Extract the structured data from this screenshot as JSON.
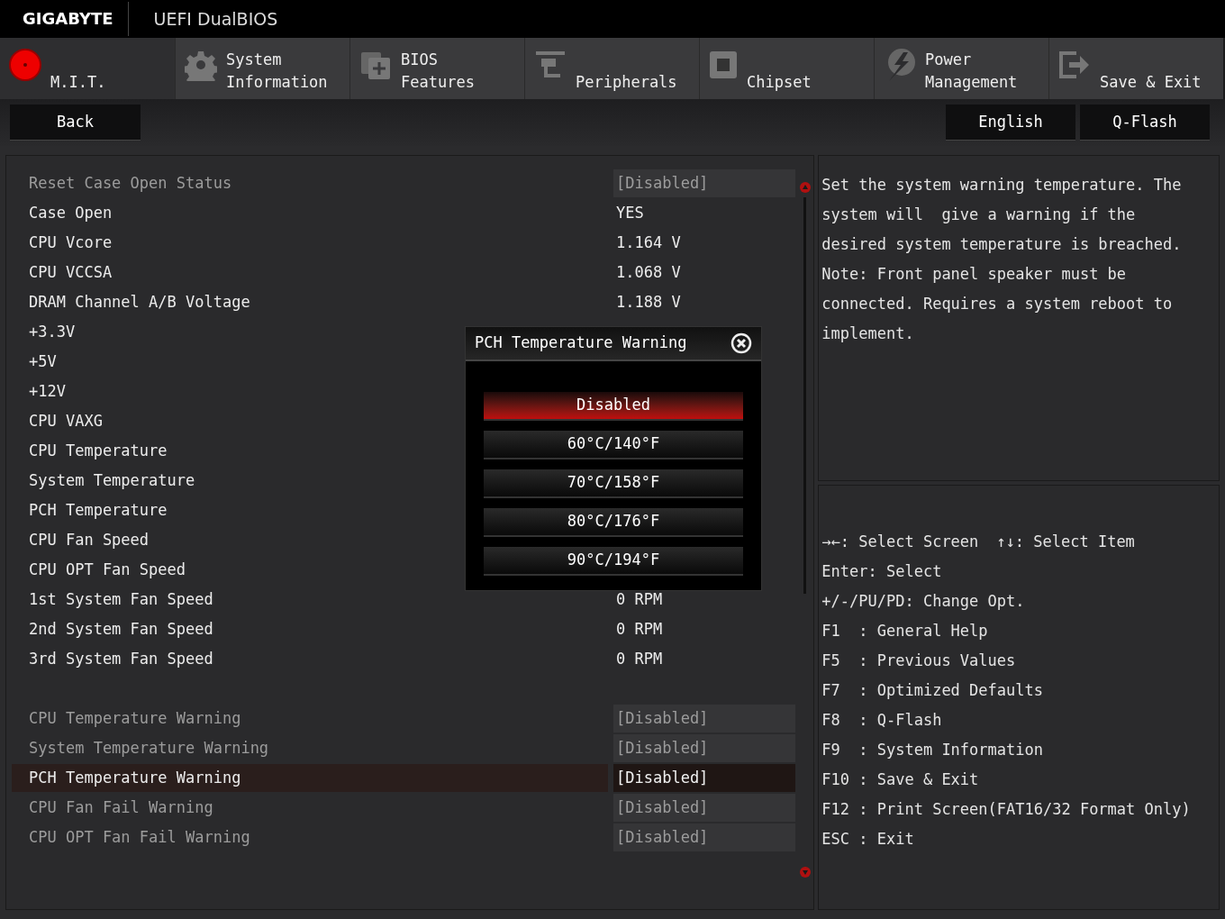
{
  "header": {
    "brand": "GIGABYTE",
    "title": "UEFI DualBIOS"
  },
  "tabs": [
    {
      "label": "M.I.T.",
      "kind": "mit",
      "selected": true
    },
    {
      "label": "System\nInformation",
      "kind": "gear",
      "selected": false
    },
    {
      "label": "BIOS\nFeatures",
      "kind": "card",
      "selected": false
    },
    {
      "label": "Peripherals",
      "kind": "plug",
      "selected": false
    },
    {
      "label": "Chipset",
      "kind": "chip",
      "selected": false
    },
    {
      "label": "Power\nManagement",
      "kind": "power",
      "selected": false
    },
    {
      "label": "Save & Exit",
      "kind": "exit",
      "selected": false
    }
  ],
  "back_button": "Back",
  "right_buttons": [
    "English",
    "Q-Flash"
  ],
  "sections": [
    {
      "rows": [
        {
          "label": "Reset Case Open Status",
          "value": "[Disabled]",
          "kind": "option",
          "disabled": true,
          "selected": false
        },
        {
          "label": "Case Open",
          "value": "YES",
          "kind": "reading",
          "disabled": false,
          "selected": false
        },
        {
          "label": "CPU Vcore",
          "value": "1.164 V",
          "kind": "reading",
          "disabled": false,
          "selected": false
        },
        {
          "label": "CPU VCCSA",
          "value": "1.068 V",
          "kind": "reading",
          "disabled": false,
          "selected": false
        },
        {
          "label": "DRAM Channel A/B Voltage",
          "value": "1.188 V",
          "kind": "reading",
          "disabled": false,
          "selected": false
        },
        {
          "label": "+3.3V",
          "disabled": false,
          "selected": false
        },
        {
          "label": "+5V",
          "disabled": false,
          "selected": false
        },
        {
          "label": "+12V",
          "disabled": false,
          "selected": false
        },
        {
          "label": "CPU VAXG",
          "disabled": false,
          "selected": false
        },
        {
          "label": "CPU Temperature",
          "disabled": false,
          "selected": false
        },
        {
          "label": "System Temperature",
          "disabled": false,
          "selected": false
        },
        {
          "label": "PCH Temperature",
          "disabled": false,
          "selected": false
        },
        {
          "label": "CPU Fan Speed",
          "disabled": false,
          "selected": false
        },
        {
          "label": "CPU OPT Fan Speed",
          "disabled": false,
          "selected": false
        },
        {
          "label": "1st System Fan Speed",
          "value": "0 RPM",
          "kind": "reading",
          "disabled": false,
          "selected": false
        },
        {
          "label": "2nd System Fan Speed",
          "value": "0 RPM",
          "kind": "reading",
          "disabled": false,
          "selected": false
        },
        {
          "label": "3rd System Fan Speed",
          "value": "0 RPM",
          "kind": "reading",
          "disabled": false,
          "selected": false
        }
      ]
    },
    {
      "rows": [
        {
          "label": "CPU Temperature Warning",
          "value": "[Disabled]",
          "kind": "option",
          "disabled": true,
          "selected": false
        },
        {
          "label": "System Temperature Warning",
          "value": "[Disabled]",
          "kind": "option",
          "disabled": true,
          "selected": false
        },
        {
          "label": "PCH Temperature Warning",
          "value": "[Disabled]",
          "kind": "option",
          "disabled": false,
          "selected": true
        },
        {
          "label": "CPU Fan Fail Warning",
          "value": "[Disabled]",
          "kind": "option",
          "disabled": true,
          "selected": false
        },
        {
          "label": "CPU OPT Fan Fail Warning",
          "value": "[Disabled]",
          "kind": "option",
          "disabled": true,
          "selected": false
        }
      ]
    }
  ],
  "popup": {
    "title": "PCH Temperature Warning",
    "options": [
      {
        "label": "Disabled",
        "selected": true
      },
      {
        "label": "60°C/140°F",
        "selected": false
      },
      {
        "label": "70°C/158°F",
        "selected": false
      },
      {
        "label": "80°C/176°F",
        "selected": false
      },
      {
        "label": "90°C/194°F",
        "selected": false
      }
    ]
  },
  "help_text": "Set the system warning temperature. The system will  give a warning if the desired system temperature is breached. Note: Front panel speaker must be connected. Requires a system reboot to implement.",
  "key_help": [
    {
      "keys": "→←: Select Screen",
      "extra": "↑↓: Select Item"
    },
    {
      "keys": "Enter: Select"
    },
    {
      "keys": "+/-/PU/PD: Change Opt."
    },
    {
      "keys": "F1  : General Help"
    },
    {
      "keys": "F5  : Previous Values"
    },
    {
      "keys": "F7  : Optimized Defaults"
    },
    {
      "keys": "F8  : Q-Flash"
    },
    {
      "keys": "F9  : System Information"
    },
    {
      "keys": "F10 : Save & Exit"
    },
    {
      "keys": "F12 : Print Screen(FAT16/32 Format Only)"
    },
    {
      "keys": "ESC : Exit"
    }
  ]
}
